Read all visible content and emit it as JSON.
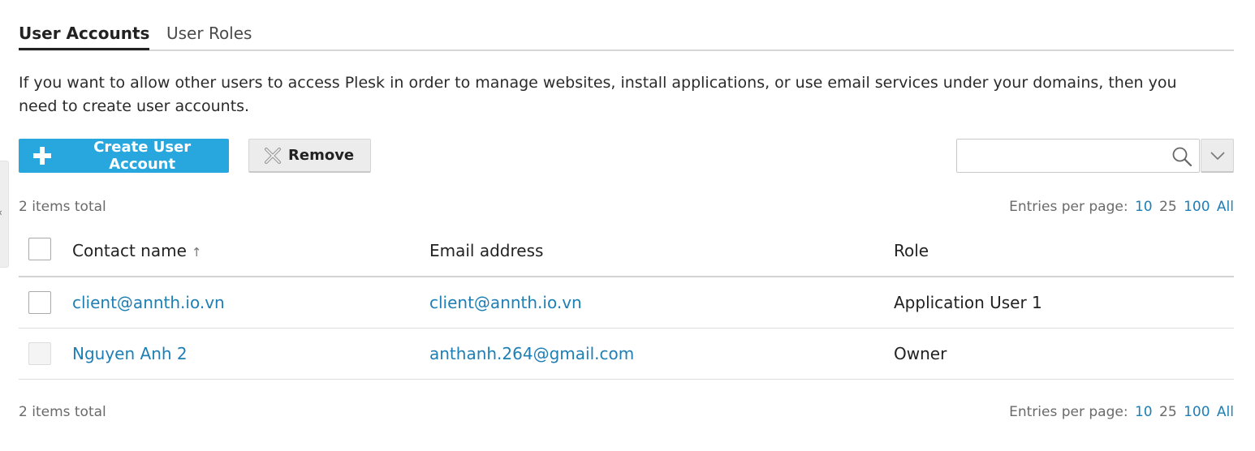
{
  "tabs": [
    {
      "label": "User Accounts",
      "active": true
    },
    {
      "label": "User Roles",
      "active": false
    }
  ],
  "description": "If you want to allow other users to access Plesk in order to manage websites, install applications, or use email services under your domains, then you need to create user accounts.",
  "toolbar": {
    "create_label": "Create User Account",
    "create_icon": "plus-icon",
    "remove_label": "Remove",
    "remove_icon": "cross-icon",
    "search_placeholder": "",
    "search_icon": "search-icon",
    "toggle_icon": "chevron-down-icon"
  },
  "pagination": {
    "total_text": "2 items total",
    "entries_label": "Entries per page:",
    "options": [
      "10",
      "25",
      "100",
      "All"
    ],
    "current": "25"
  },
  "table": {
    "columns": [
      {
        "label": "Contact name",
        "sort_indicator": "↑"
      },
      {
        "label": "Email address"
      },
      {
        "label": "Role"
      }
    ],
    "rows": [
      {
        "contact": "client@annth.io.vn",
        "email": "client@annth.io.vn",
        "role": "Application User 1",
        "selectable": true
      },
      {
        "contact": "Nguyen Anh 2",
        "email": "anthanh.264@gmail.com",
        "role": "Owner",
        "selectable": false
      }
    ]
  },
  "colors": {
    "primary": "#28a7de",
    "link": "#1e7fb5",
    "muted_text": "#6a6a6a"
  }
}
